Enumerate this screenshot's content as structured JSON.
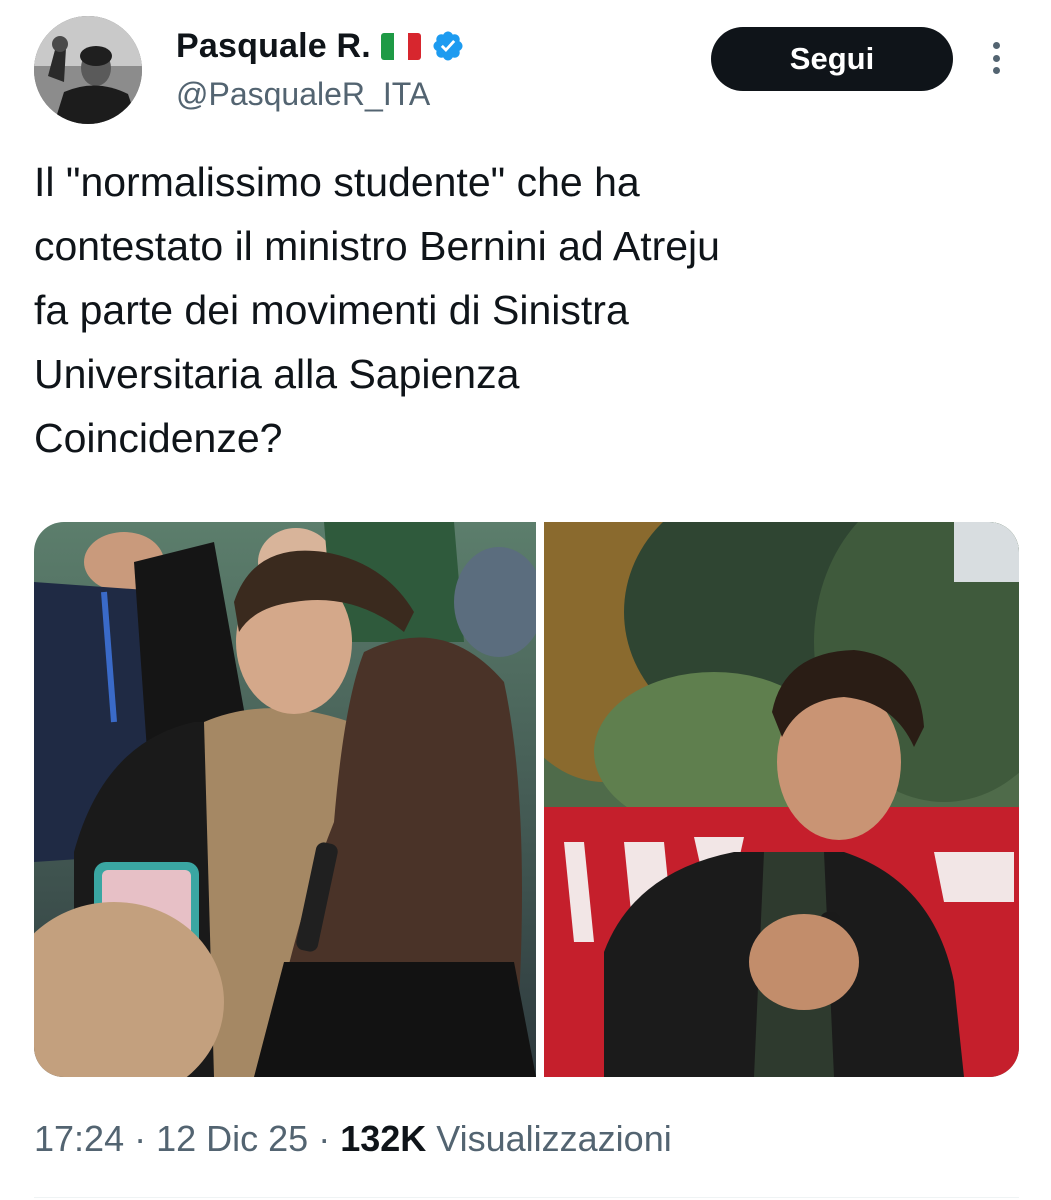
{
  "author": {
    "display_name": "Pasquale R.",
    "handle": "@PasqualeR_ITA",
    "flag_icon": "italy-flag-icon",
    "verified_icon": "verified-badge-icon",
    "verified_color": "#1d9bf0"
  },
  "follow_button": {
    "label": "Segui"
  },
  "tweet": {
    "lines": [
      "Il \"normalissimo studente\" che ha",
      "contestato il ministro Bernini ad Atreju",
      "fa parte dei movimenti di Sinistra",
      "Universitaria alla Sapienza",
      "Coincidenze?"
    ]
  },
  "media": {
    "photos": [
      {
        "icon": "photo-icon"
      },
      {
        "icon": "photo-icon"
      }
    ]
  },
  "meta": {
    "time": "17:24",
    "sep1": " · ",
    "date": "12 Dic 25",
    "sep2": " · ",
    "views": "132K",
    "views_label": " Visualizzazioni"
  },
  "colors": {
    "text_primary": "#0f1419",
    "text_secondary": "#536471",
    "button_bg": "#0f1419",
    "button_text": "#ffffff"
  }
}
